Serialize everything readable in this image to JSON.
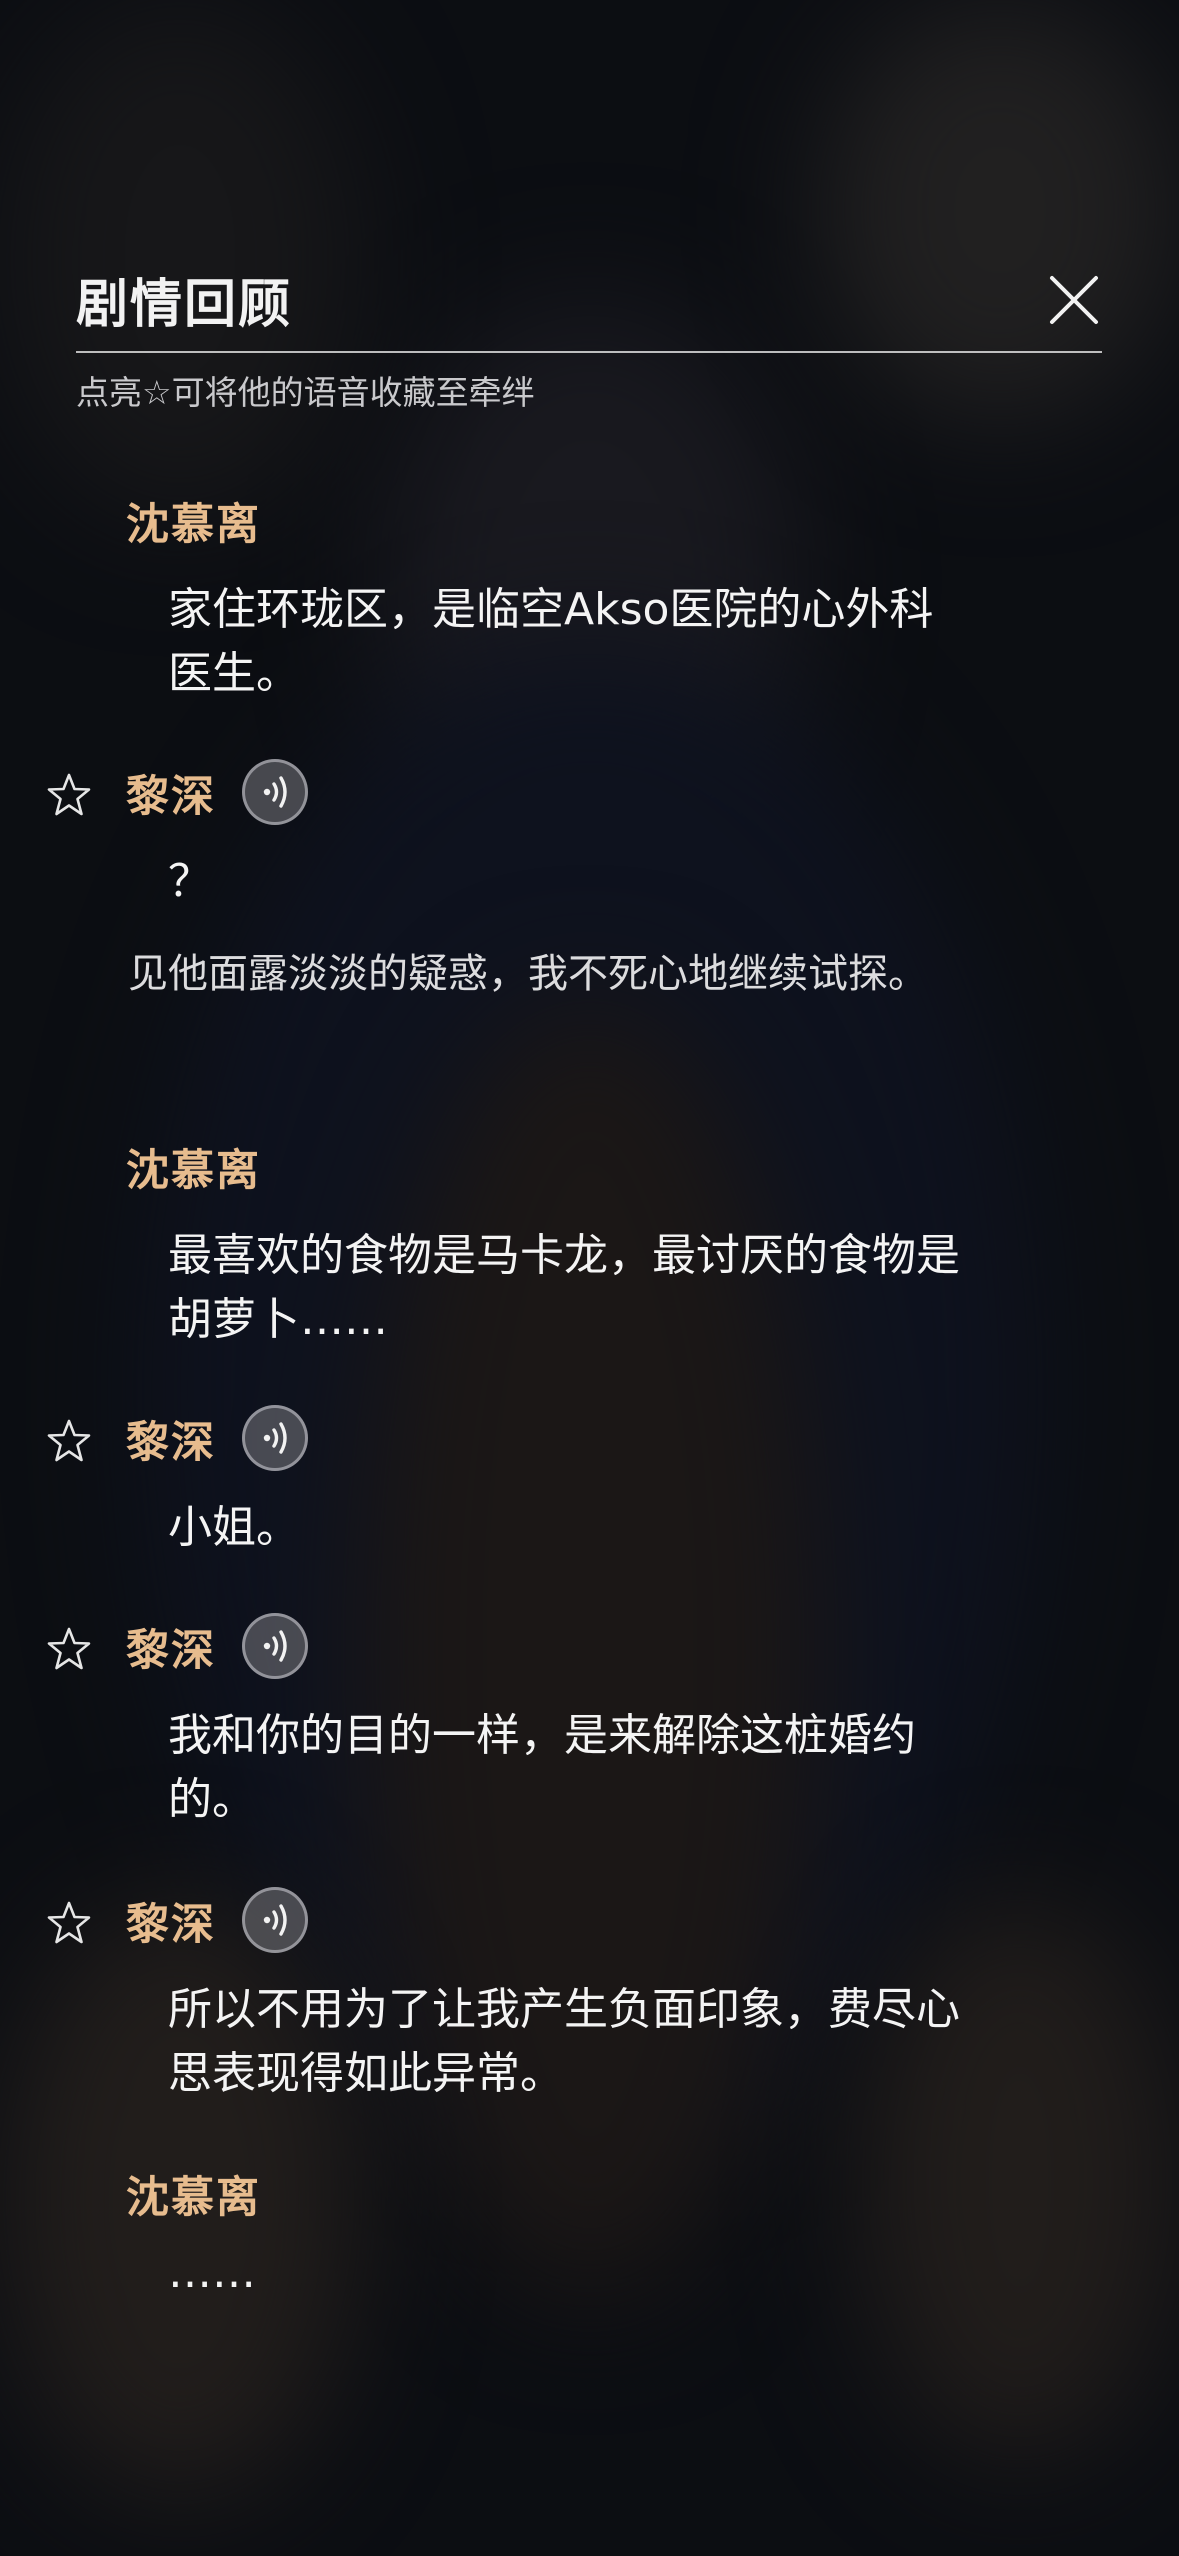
{
  "header": {
    "title": "剧情回顾",
    "hint": "点亮☆可将他的语音收藏至牵绊"
  },
  "entries": [
    {
      "speaker": "沈慕离",
      "lines": [
        "家住环珑区，是临空Akso医院的心外科",
        "医生。"
      ]
    },
    {
      "speaker": "黎深",
      "lines": [
        "？"
      ]
    },
    {
      "narration": "见他面露淡淡的疑惑，我不死心地继续试探。"
    },
    {
      "speaker": "沈慕离",
      "lines": [
        "最喜欢的食物是马卡龙，最讨厌的食物是",
        "胡萝卜……"
      ]
    },
    {
      "speaker": "黎深",
      "lines": [
        "小姐。"
      ]
    },
    {
      "speaker": "黎深",
      "lines": [
        "我和你的目的一样，是来解除这桩婚约",
        "的。"
      ]
    },
    {
      "speaker": "黎深",
      "lines": [
        "所以不用为了让我产生负面印象，费尽心",
        "思表现得如此异常。"
      ]
    },
    {
      "speaker": "沈慕离",
      "lines": [
        "……"
      ]
    }
  ],
  "icons": {
    "close": "close-icon",
    "star": "star-outline-icon",
    "voice": "voice-play-icon"
  },
  "colors": {
    "speaker": "#e7bc8e",
    "text": "#f4f4f4",
    "background": "#101217"
  }
}
